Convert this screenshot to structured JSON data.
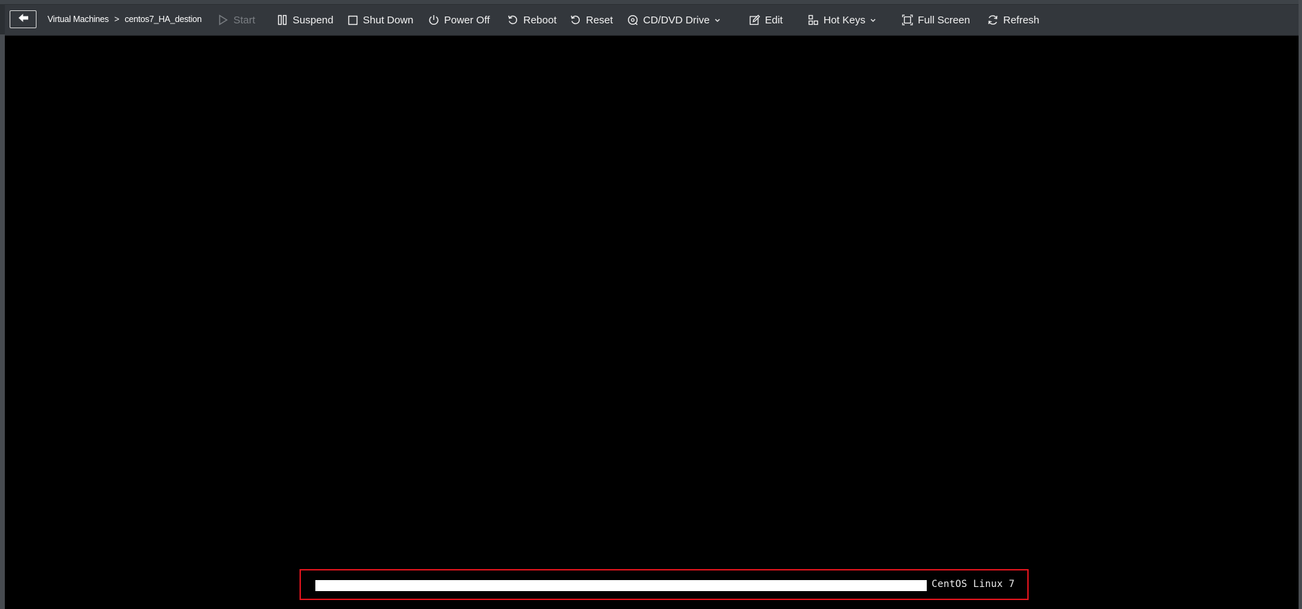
{
  "breadcrumb": {
    "parent": "Virtual Machines",
    "separator": ">",
    "current": "centos7_HA_destion"
  },
  "toolbar": {
    "back_icon": "arrow-left-icon",
    "start": {
      "label": "Start",
      "icon": "play-icon",
      "disabled": true
    },
    "suspend": {
      "label": "Suspend",
      "icon": "pause-icon"
    },
    "shutdown": {
      "label": "Shut Down",
      "icon": "square-icon"
    },
    "poweroff": {
      "label": "Power Off",
      "icon": "power-icon"
    },
    "reboot": {
      "label": "Reboot",
      "icon": "rotate-ccw-icon"
    },
    "reset": {
      "label": "Reset",
      "icon": "rotate-ccw-icon"
    },
    "cddvd": {
      "label": "CD/DVD Drive",
      "icon": "disc-icon",
      "has_dropdown": true
    },
    "edit": {
      "label": "Edit",
      "icon": "pencil-icon"
    },
    "hotkeys": {
      "label": "Hot Keys",
      "icon": "keyboard-icon",
      "has_dropdown": true
    },
    "fullscreen": {
      "label": "Full Screen",
      "icon": "fullscreen-icon"
    },
    "refresh": {
      "label": "Refresh",
      "icon": "refresh-icon"
    }
  },
  "console": {
    "boot_progress": 1.0,
    "os_label": "CentOS Linux 7",
    "highlight_color": "#e0141d"
  },
  "colors": {
    "toolbar_bg": "#33373c",
    "text": "#f2f2f2",
    "disabled_text": "#7b7f84",
    "console_bg": "#000000"
  }
}
